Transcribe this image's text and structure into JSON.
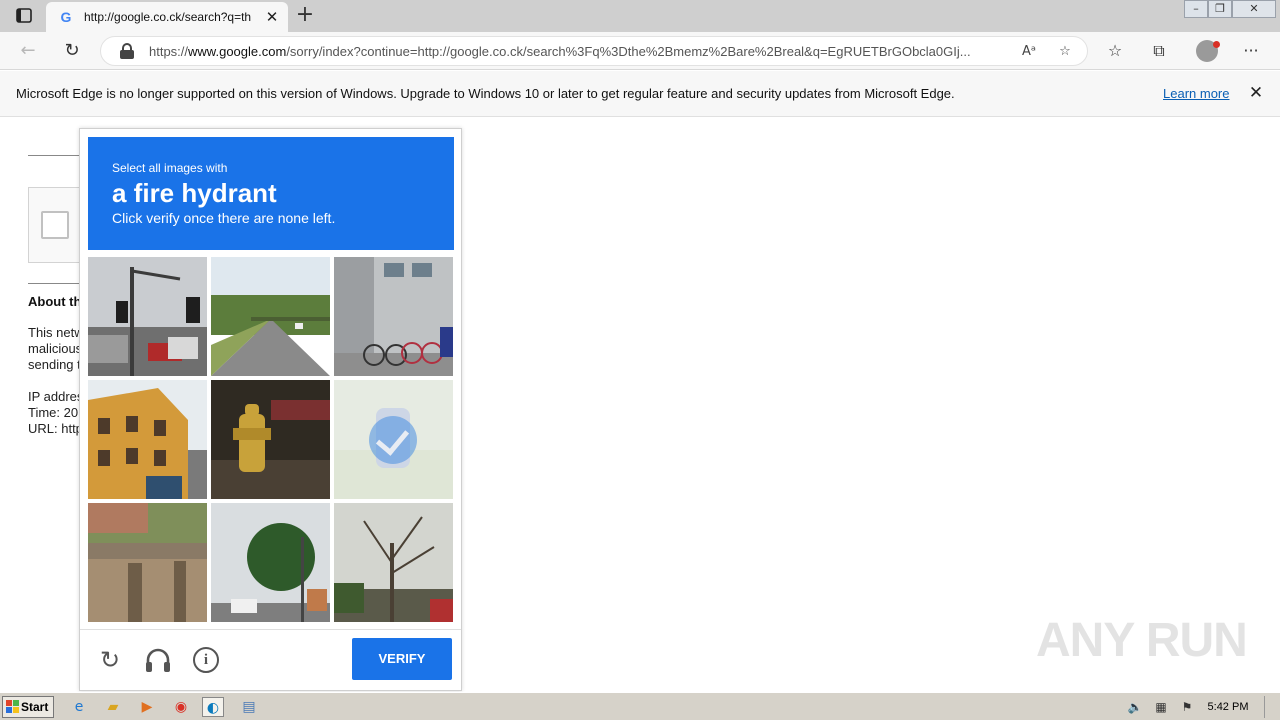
{
  "browser": {
    "tab": {
      "favicon": "G",
      "title": "http://google.co.ck/search?q=th",
      "close": "✕"
    },
    "new_tab": "+",
    "window_controls": {
      "minimize": "–",
      "restore": "❐",
      "close": "✕"
    },
    "nav": {
      "back": "←",
      "refresh": "↻"
    },
    "address": {
      "prefix": "https://",
      "domain": "www.google.com",
      "path": "/sorry/index?continue=http://google.co.ck/search%3Fq%3Dthe%2Bmemz%2Bare%2Breal&q=EgRUETBrGObcla0GIj..."
    },
    "omni_icons": {
      "read_aloud": "Aᵃ",
      "add_favorite": "☆"
    },
    "toolbar_icons": {
      "favorites": "☆",
      "collections": "⧉",
      "more": "···"
    }
  },
  "infobar": {
    "message": "Microsoft Edge is no longer supported on this version of Windows. Upgrade to Windows 10 or later to get regular feature and security updates from Microsoft Edge.",
    "link": "Learn more",
    "close": "✕"
  },
  "page": {
    "about_title": "About th",
    "lines": [
      "This netw",
      "malicious",
      "sending t",
      "IP addres",
      "Time: 20",
      "URL: http"
    ]
  },
  "captcha": {
    "instruction_pre": "Select all images with",
    "target": "a fire hydrant",
    "instruction_post": "Click verify once there are none left.",
    "tiles": [
      {
        "name": "traffic-light-intersection",
        "selected": false
      },
      {
        "name": "highway-road",
        "selected": false
      },
      {
        "name": "bicycles-by-building",
        "selected": false
      },
      {
        "name": "yellow-building",
        "selected": false
      },
      {
        "name": "fire-hydrant",
        "selected": false
      },
      {
        "name": "fire-hydrant-faded",
        "selected": true
      },
      {
        "name": "stone-wall",
        "selected": false
      },
      {
        "name": "street-with-trees",
        "selected": false
      },
      {
        "name": "bare-tree-street",
        "selected": false
      }
    ],
    "icons": {
      "reload": "↻",
      "audio": "🎧",
      "info": "i"
    },
    "verify_label": "VERIFY",
    "accent_color": "#1a73e8"
  },
  "watermark": "ANY RUN",
  "taskbar": {
    "start_label": "Start",
    "apps": [
      "ie-icon",
      "folder-icon",
      "media-player-icon",
      "chrome-icon",
      "edge-icon",
      "notepad-icon"
    ],
    "clock": "5:42 PM"
  }
}
